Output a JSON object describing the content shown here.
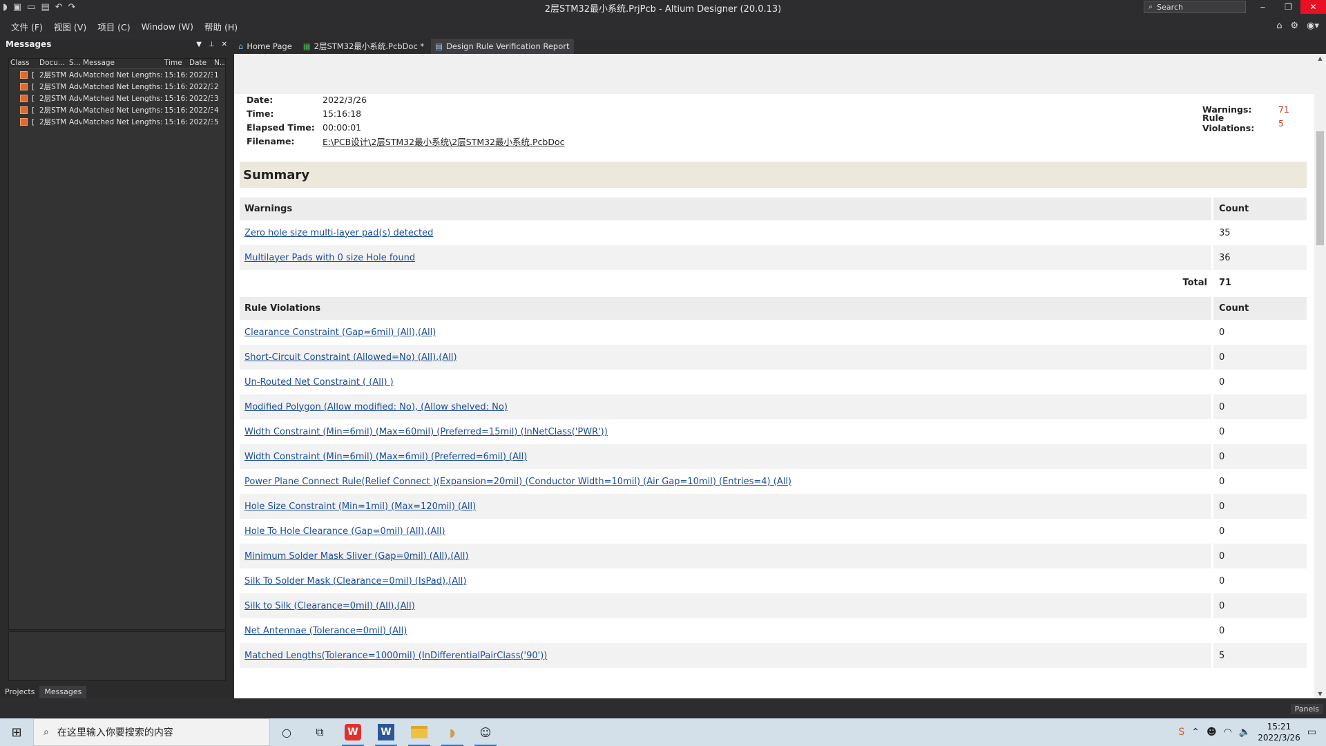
{
  "window": {
    "title": "2层STM32最小系统.PrjPcb - Altium Designer (20.0.13)",
    "search_placeholder": "Search"
  },
  "menu": [
    "文件 (F)",
    "视图 (V)",
    "项目 (C)",
    "Window (W)",
    "帮助 (H)"
  ],
  "messages_panel": {
    "title": "Messages",
    "columns": [
      "Class",
      "Docu...",
      "S...",
      "Message",
      "Time",
      "Date",
      "N..."
    ],
    "rows": [
      {
        "class": "[",
        "doc": "2层STM",
        "source": "Adv",
        "message": "Matched Net Lengths:",
        "time": "15:16:",
        "date": "2022/3",
        "n": "1"
      },
      {
        "class": "[",
        "doc": "2层STM",
        "source": "Adv",
        "message": "Matched Net Lengths:",
        "time": "15:16:",
        "date": "2022/3",
        "n": "2"
      },
      {
        "class": "[",
        "doc": "2层STM",
        "source": "Adv",
        "message": "Matched Net Lengths:",
        "time": "15:16:",
        "date": "2022/3",
        "n": "3"
      },
      {
        "class": "[",
        "doc": "2层STM",
        "source": "Adv",
        "message": "Matched Net Lengths:",
        "time": "15:16:",
        "date": "2022/3",
        "n": "4"
      },
      {
        "class": "[",
        "doc": "2层STM",
        "source": "Adv",
        "message": "Matched Net Lengths:",
        "time": "15:16:",
        "date": "2022/3",
        "n": "5"
      }
    ],
    "tabs": [
      "Projects",
      "Messages"
    ]
  },
  "doc_tabs": [
    "Home Page",
    "2层STM32最小系统.PcbDoc *",
    "Design Rule Verification Report"
  ],
  "report": {
    "meta": [
      {
        "key": "Date:",
        "value": "2022/3/26"
      },
      {
        "key": "Time:",
        "value": "15:16:18"
      },
      {
        "key": "Elapsed Time:",
        "value": "00:00:01"
      },
      {
        "key": "Filename:",
        "value": "E:\\PCB设计\\2层STM32最小系统\\2层STM32最小系统.PcbDoc"
      }
    ],
    "warnings_count_label": "Warnings:",
    "warnings_count": "71",
    "violations_count_label": "Rule Violations:",
    "violations_count": "5",
    "summary_title": "Summary",
    "warnings_table": {
      "header": "Warnings",
      "count_header": "Count",
      "rows": [
        {
          "name": "Zero hole size multi-layer pad(s) detected",
          "count": "35"
        },
        {
          "name": "Multilayer Pads with 0 size Hole found",
          "count": "36"
        }
      ],
      "total_label": "Total",
      "total": "71"
    },
    "violations_table": {
      "header": "Rule Violations",
      "count_header": "Count",
      "rows": [
        {
          "name": "Clearance Constraint (Gap=6mil) (All),(All)",
          "count": "0"
        },
        {
          "name": "Short-Circuit Constraint (Allowed=No) (All),(All)",
          "count": "0"
        },
        {
          "name": "Un-Routed Net Constraint ( (All) )",
          "count": "0"
        },
        {
          "name": "Modified Polygon (Allow modified: No), (Allow shelved: No)",
          "count": "0"
        },
        {
          "name": "Width Constraint (Min=6mil) (Max=60mil) (Preferred=15mil) (InNetClass('PWR'))",
          "count": "0"
        },
        {
          "name": "Width Constraint (Min=6mil) (Max=6mil) (Preferred=6mil) (All)",
          "count": "0"
        },
        {
          "name": "Power Plane Connect Rule(Relief Connect )(Expansion=20mil) (Conductor Width=10mil) (Air Gap=10mil) (Entries=4) (All)",
          "count": "0"
        },
        {
          "name": "Hole Size Constraint (Min=1mil) (Max=120mil) (All)",
          "count": "0"
        },
        {
          "name": "Hole To Hole Clearance (Gap=0mil) (All),(All)",
          "count": "0"
        },
        {
          "name": "Minimum Solder Mask Sliver (Gap=0mil) (All),(All)",
          "count": "0"
        },
        {
          "name": "Silk To Solder Mask (Clearance=0mil) (IsPad),(All)",
          "count": "0"
        },
        {
          "name": "Silk to Silk (Clearance=0mil) (All),(All)",
          "count": "0"
        },
        {
          "name": "Net Antennae (Tolerance=0mil) (All)",
          "count": "0"
        },
        {
          "name": "Matched Lengths(Tolerance=1000mil) (InDifferentialPairClass('90'))",
          "count": "5"
        }
      ]
    }
  },
  "statusbar": {
    "panels_label": "Panels"
  },
  "taskbar": {
    "search_placeholder": "在这里输入你要搜索的内容",
    "time": "15:21",
    "date": "2022/3/26"
  },
  "colors": {
    "accent_red": "#c0392b",
    "link": "#1a4d9c",
    "summary_bg": "#ede8dc"
  }
}
